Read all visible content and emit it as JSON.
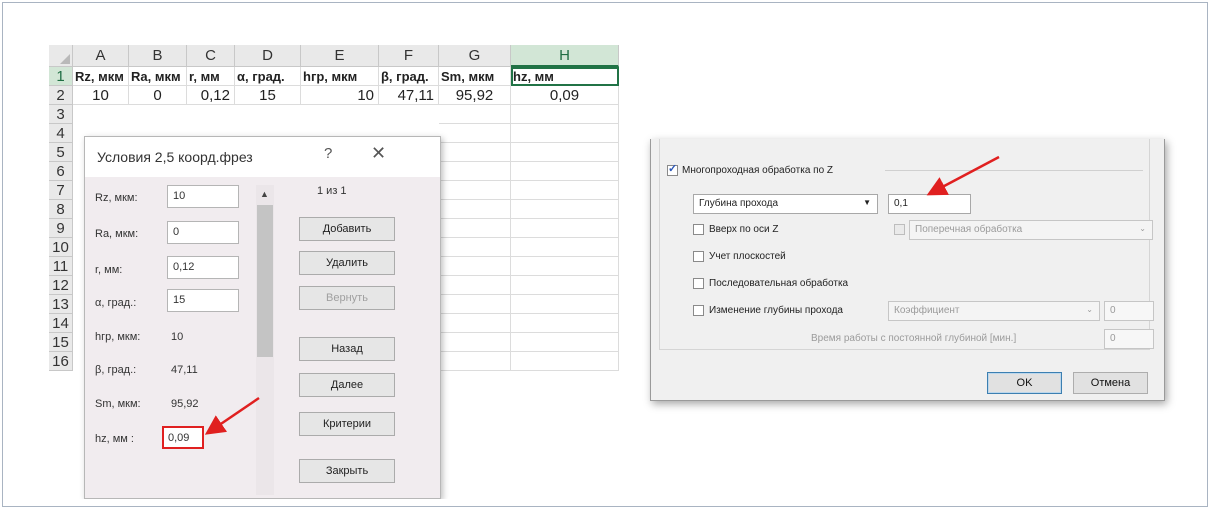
{
  "excel": {
    "columns": [
      "A",
      "B",
      "C",
      "D",
      "E",
      "F",
      "G",
      "H"
    ],
    "rows": [
      "1",
      "2",
      "3",
      "4",
      "5",
      "6",
      "7",
      "8",
      "9",
      "10",
      "11",
      "12",
      "13",
      "14",
      "15",
      "16"
    ],
    "header_row": [
      "Rz, мкм",
      "Ra, мкм",
      "r, мм",
      "α, град.",
      "hгр, мкм",
      "β, град.",
      "Sm, мкм",
      "hz, мм"
    ],
    "data_row": [
      "10",
      "0",
      "0,12",
      "15",
      "10",
      "47,11",
      "95,92",
      "0,09"
    ]
  },
  "form": {
    "title": "Условия 2,5 коорд.фрез",
    "help": "?",
    "close": "✕",
    "counter": "1 из 1",
    "fields": [
      {
        "label": "Rz, мкм:",
        "value": "10"
      },
      {
        "label": "Ra, мкм:",
        "value": "0"
      },
      {
        "label": "r, мм:",
        "value": "0,12"
      },
      {
        "label": "α, град.:",
        "value": "15"
      },
      {
        "label": "hгр, мкм:",
        "value": "10"
      },
      {
        "label": "β, град.:",
        "value": "47,11"
      },
      {
        "label": "Sm, мкм:",
        "value": "95,92"
      },
      {
        "label": "hz, мм :",
        "value": "0,09"
      }
    ],
    "buttons": {
      "add": "Добавить",
      "delete": "Удалить",
      "restore": "Вернуть",
      "back": "Назад",
      "next": "Далее",
      "criteria": "Критерии",
      "close": "Закрыть"
    }
  },
  "cam": {
    "multipass_label": "Многопроходная обработка по Z",
    "depth_combo": "Глубина прохода",
    "depth_value": "0,1",
    "up_z_label": "Вверх по оси Z",
    "cross_combo": "Поперечная обработка",
    "planes_label": "Учет плоскостей",
    "sequential_label": "Последовательная обработка",
    "change_depth_label": "Изменение глубины прохода",
    "coef_combo": "Коэффициент",
    "coef_value": "0",
    "time_label": "Время работы с постоянной глубиной [мин.]",
    "time_value": "0",
    "ok_label": "OK",
    "cancel_label": "Отмена"
  },
  "colors": {
    "excel_accent": "#217346",
    "highlight_red": "#e02020",
    "checkbox_blue": "#2c58b9"
  }
}
